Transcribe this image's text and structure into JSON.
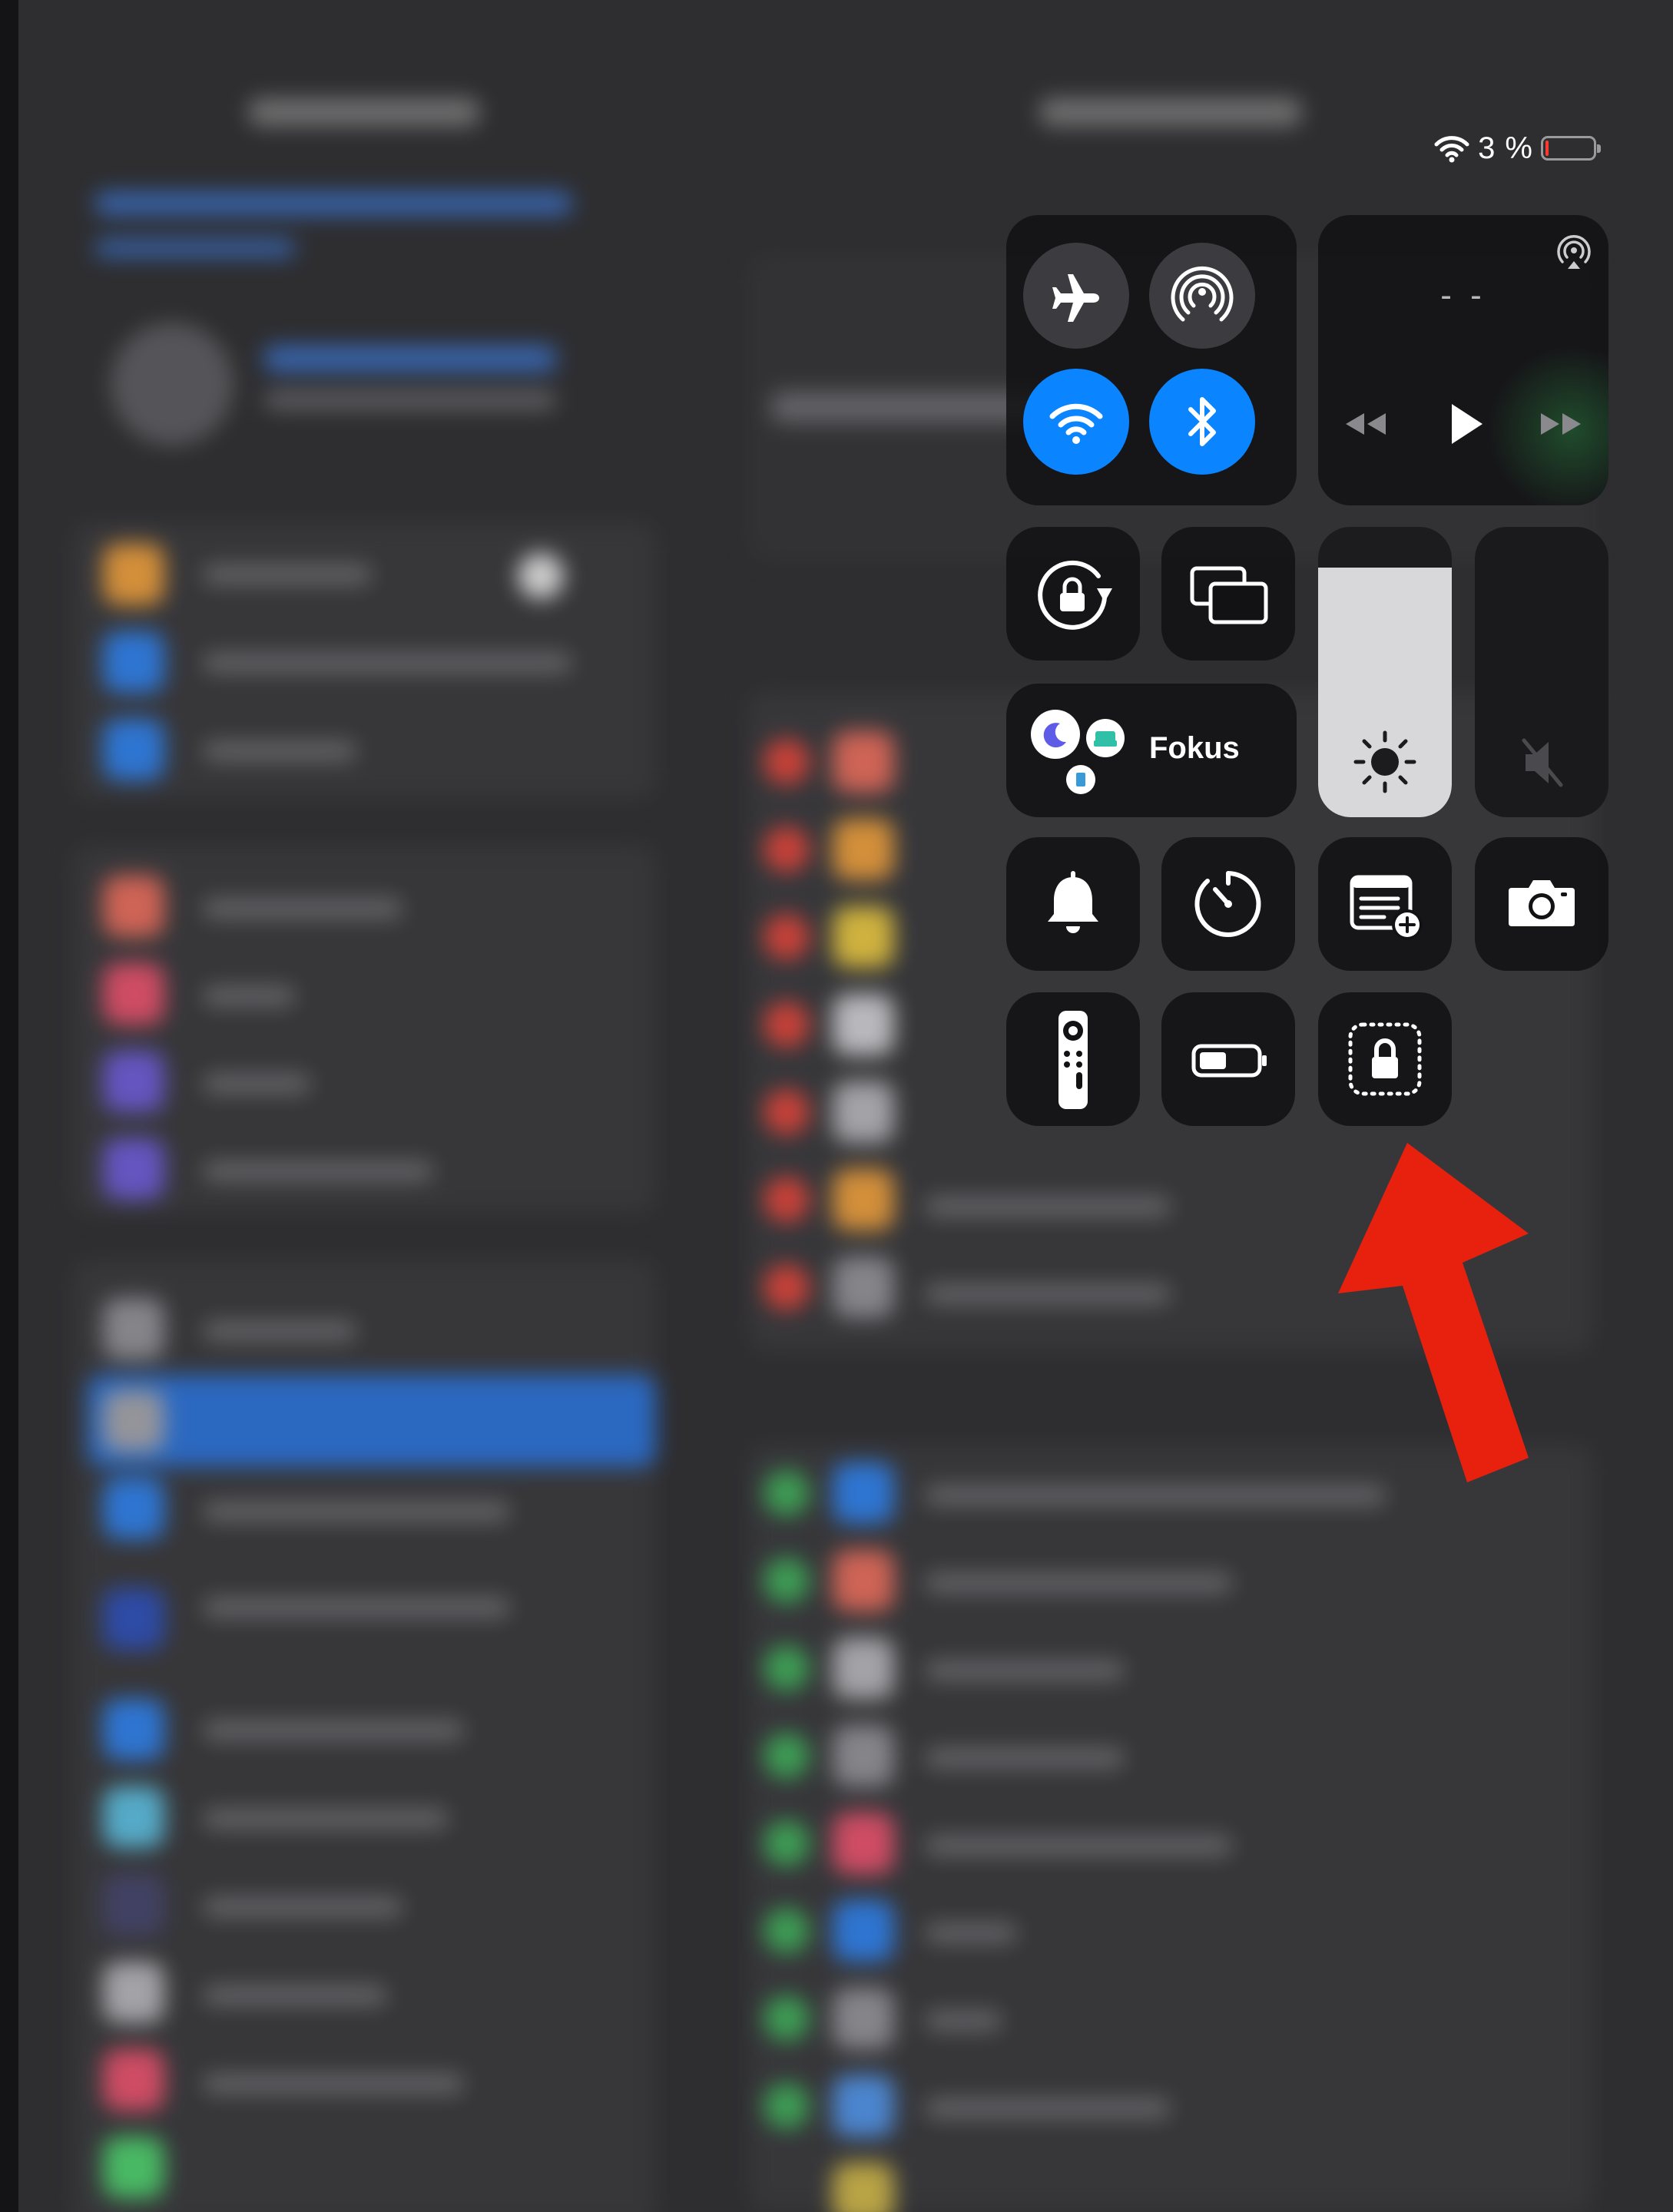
{
  "status_bar": {
    "battery_percent": "3 %",
    "battery_level": 0.03,
    "battery_color": "#ff3b30",
    "wifi_icon": "wifi-icon"
  },
  "connectivity": {
    "airplane": {
      "icon": "airplane-icon",
      "on": false
    },
    "airdrop": {
      "icon": "airdrop-icon",
      "on": false
    },
    "wifi": {
      "icon": "wifi-icon",
      "on": true
    },
    "bluetooth": {
      "icon": "bluetooth-icon",
      "on": true
    },
    "active_color": "#0a84ff"
  },
  "media": {
    "title": "- -",
    "airplay_icon": "airplay-icon",
    "controls": [
      "rewind-icon",
      "play-icon",
      "fast-forward-icon"
    ]
  },
  "focus": {
    "label": "Fokus",
    "icons": [
      "moon-icon",
      "bed-icon",
      "badge-icon"
    ]
  },
  "sliders": {
    "brightness_level": 0.86,
    "volume_level": 0.0,
    "volume_muted": true
  },
  "toggles": [
    "rotation-lock-icon",
    "screen-mirroring-icon",
    "bell-icon",
    "timer-icon",
    "quick-note-icon",
    "camera-icon",
    "apple-tv-remote-icon",
    "low-power-mode-icon",
    "guided-access-lock-icon"
  ],
  "annotation": {
    "arrow_color": "#e8210f",
    "points_to": "guided-access-lock"
  }
}
